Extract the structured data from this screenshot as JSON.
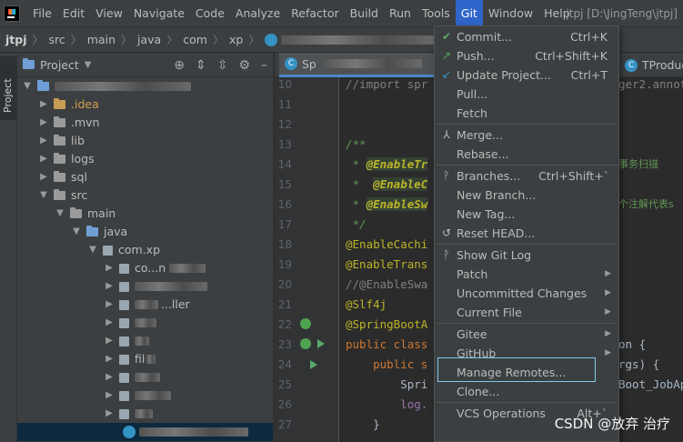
{
  "menubar": {
    "items": [
      "File",
      "Edit",
      "View",
      "Navigate",
      "Code",
      "Analyze",
      "Refactor",
      "Build",
      "Run",
      "Tools",
      "Git",
      "Window",
      "Help"
    ],
    "active": "Git",
    "window_title": "jtpj [D:\\JingTeng\\jtpj]"
  },
  "breadcrumb": {
    "items": [
      "jtpj",
      "src",
      "main",
      "java",
      "com",
      "xp"
    ]
  },
  "toolstrip": {
    "project_tab": "Project"
  },
  "project_panel": {
    "title": "Project",
    "tree": [
      {
        "label": ".idea",
        "style": "orange",
        "icon": "folder-orange"
      },
      {
        "label": ".mvn",
        "icon": "folder"
      },
      {
        "label": "lib",
        "icon": "folder"
      },
      {
        "label": "logs",
        "icon": "folder"
      },
      {
        "label": "sql",
        "icon": "folder"
      },
      {
        "label": "src",
        "icon": "folder"
      },
      {
        "label": "main",
        "icon": "folder"
      },
      {
        "label": "java",
        "icon": "folder-blue"
      },
      {
        "label": "com.xp",
        "icon": "package"
      },
      {
        "label": "co...n",
        "icon": "package"
      },
      {
        "label": "",
        "icon": "package"
      },
      {
        "label": "...ller",
        "icon": "package"
      },
      {
        "label": "",
        "icon": "package"
      },
      {
        "label": "",
        "icon": "package"
      },
      {
        "label": "fil",
        "icon": "package"
      },
      {
        "label": "",
        "icon": "package"
      },
      {
        "label": "",
        "icon": "package"
      },
      {
        "label": "",
        "icon": "package"
      }
    ]
  },
  "editor": {
    "tabs": [
      "Sp",
      "TProduc"
    ],
    "line_numbers": [
      "10",
      "11",
      "12",
      "13",
      "14",
      "15",
      "16",
      "17",
      "18",
      "19",
      "20",
      "21",
      "22",
      "23",
      "24",
      "25",
      "26",
      "27"
    ],
    "code": {
      "l10": "//import spr",
      "l10_right": "ger2.annot",
      "l13": "/**",
      "l14a": " * ",
      "l14b": "@EnableTr",
      "l14_right": "事务扫描",
      "l15a": " *  ",
      "l15b": "@EnableC",
      "l16a": " * ",
      "l16b": "@EnableSw",
      "l16_right": "个注解代表s",
      "l17": " */",
      "l18": "@EnableCachi",
      "l19": "@EnableTrans",
      "l20": "//@EnableSwa",
      "l21": "@Slf4j",
      "l22": "@SpringBootA",
      "l23a": "public class",
      "l23_right": "on {",
      "l24a": "    public s",
      "l24_right": "rgs) {",
      "l25a": "        Spri",
      "l25_right": "Boot_JobAp",
      "l26a": "        log.",
      "l27": "    }"
    }
  },
  "git_menu": {
    "items": [
      {
        "label": "Commit...",
        "shortcut": "Ctrl+K",
        "icon": "check-icon"
      },
      {
        "label": "Push...",
        "shortcut": "Ctrl+Shift+K",
        "icon": "push-icon"
      },
      {
        "label": "Update Project...",
        "shortcut": "Ctrl+T",
        "icon": "update-icon"
      },
      {
        "label": "Pull...",
        "shortcut": ""
      },
      {
        "label": "Fetch",
        "shortcut": ""
      },
      {
        "label": "Merge...",
        "shortcut": "",
        "icon": "merge-icon"
      },
      {
        "label": "Rebase...",
        "shortcut": ""
      },
      {
        "label": "Branches...",
        "shortcut": "Ctrl+Shift+`",
        "icon": "branch-icon"
      },
      {
        "label": "New Branch...",
        "shortcut": ""
      },
      {
        "label": "New Tag...",
        "shortcut": ""
      },
      {
        "label": "Reset HEAD...",
        "shortcut": "",
        "icon": "reset-icon"
      },
      {
        "label": "Show Git Log",
        "shortcut": "",
        "icon": "log-icon"
      },
      {
        "label": "Patch",
        "shortcut": "",
        "submenu": true
      },
      {
        "label": "Uncommitted Changes",
        "shortcut": "",
        "submenu": true
      },
      {
        "label": "Current File",
        "shortcut": "",
        "submenu": true
      },
      {
        "label": "Gitee",
        "shortcut": "",
        "submenu": true
      },
      {
        "label": "GitHub",
        "shortcut": "",
        "submenu": true
      },
      {
        "label": "Manage Remotes...",
        "shortcut": ""
      },
      {
        "label": "Clone...",
        "shortcut": ""
      },
      {
        "label": "VCS Operations",
        "shortcut": "Alt+`"
      }
    ]
  },
  "watermark": "CSDN @放弃      治疗"
}
